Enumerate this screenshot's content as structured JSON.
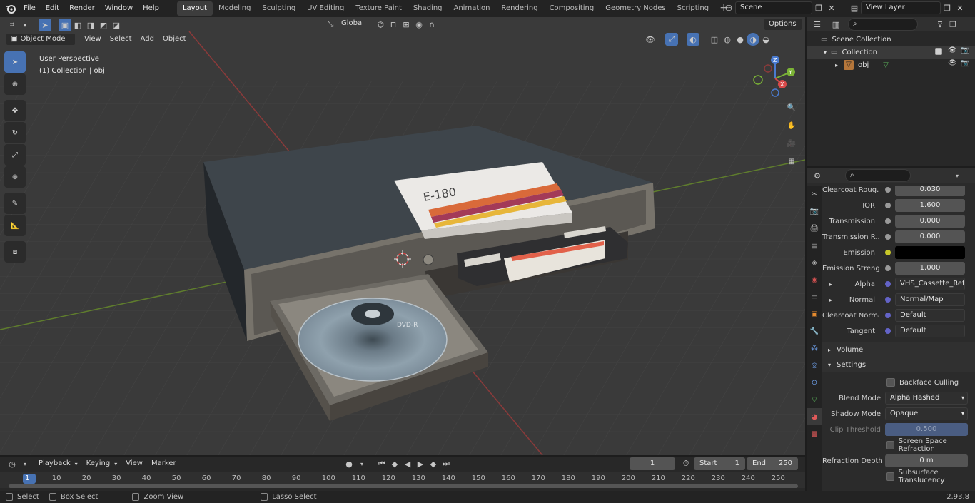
{
  "menu": {
    "file": "File",
    "edit": "Edit",
    "render": "Render",
    "window": "Window",
    "help": "Help"
  },
  "workspaces": [
    "Layout",
    "Modeling",
    "Sculpting",
    "UV Editing",
    "Texture Paint",
    "Shading",
    "Animation",
    "Rendering",
    "Compositing",
    "Geometry Nodes",
    "Scripting"
  ],
  "scene": {
    "name": "Scene",
    "view_layer": "View Layer"
  },
  "viewport": {
    "mode": "Object Mode",
    "view": "View",
    "select": "Select",
    "add": "Add",
    "object": "Object",
    "orientation": "Global",
    "options": "Options",
    "perspective": "User Perspective",
    "collection_info": "(1) Collection | obj",
    "gizmo_axes": {
      "x": "X",
      "y": "Y",
      "z": "Z"
    }
  },
  "model": {
    "cassette_label": "E-180",
    "disc_label": "DVD-R"
  },
  "outliner": {
    "scene_collection": "Scene Collection",
    "collection": "Collection",
    "object": "obj"
  },
  "properties": {
    "rows": [
      {
        "label": "Clearcoat Roug...",
        "value": "0.030",
        "dot": "#9a9a9a"
      },
      {
        "label": "IOR",
        "value": "1.600",
        "dot": "#9a9a9a"
      },
      {
        "label": "Transmission",
        "value": "0.000",
        "dot": "#9a9a9a"
      },
      {
        "label": "Transmission R...",
        "value": "0.000",
        "dot": "#9a9a9a"
      },
      {
        "label": "Emission",
        "value": "",
        "dot": "#c7c729"
      },
      {
        "label": "Emission Strengt",
        "value": "1.000",
        "dot": "#9a9a9a"
      },
      {
        "label": "Alpha",
        "value": "VHS_Cassette_Refr...",
        "dot": "#6363c7"
      },
      {
        "label": "Normal",
        "value": "Normal/Map",
        "dot": "#6363c7"
      },
      {
        "label": "Clearcoat Normal",
        "value": "Default",
        "dot": "#6363c7"
      },
      {
        "label": "Tangent",
        "value": "Default",
        "dot": "#6363c7"
      }
    ],
    "volume": "Volume",
    "settings": "Settings",
    "backface_culling": "Backface Culling",
    "blend_mode_label": "Blend Mode",
    "blend_mode": "Alpha Hashed",
    "shadow_mode_label": "Shadow Mode",
    "shadow_mode": "Opaque",
    "clip_threshold_label": "Clip Threshold",
    "clip_threshold": "0.500",
    "screen_space_refraction": "Screen Space Refraction",
    "refraction_depth_label": "Refraction Depth",
    "refraction_depth": "0 m",
    "subsurface_translucency": "Subsurface Translucency"
  },
  "timeline": {
    "playback": "Playback",
    "keying": "Keying",
    "view": "View",
    "marker": "Marker",
    "current_frame": "1",
    "start_label": "Start",
    "start": "1",
    "end_label": "End",
    "end": "250",
    "ticks": [
      "1",
      "10",
      "20",
      "30",
      "40",
      "50",
      "60",
      "70",
      "80",
      "90",
      "100",
      "110",
      "120",
      "130",
      "140",
      "150",
      "160",
      "170",
      "180",
      "190",
      "200",
      "210",
      "220",
      "230",
      "240",
      "250"
    ]
  },
  "status": {
    "select": "Select",
    "box_select": "Box Select",
    "zoom_view": "Zoom View",
    "lasso_select": "Lasso Select",
    "version": "2.93.8"
  }
}
